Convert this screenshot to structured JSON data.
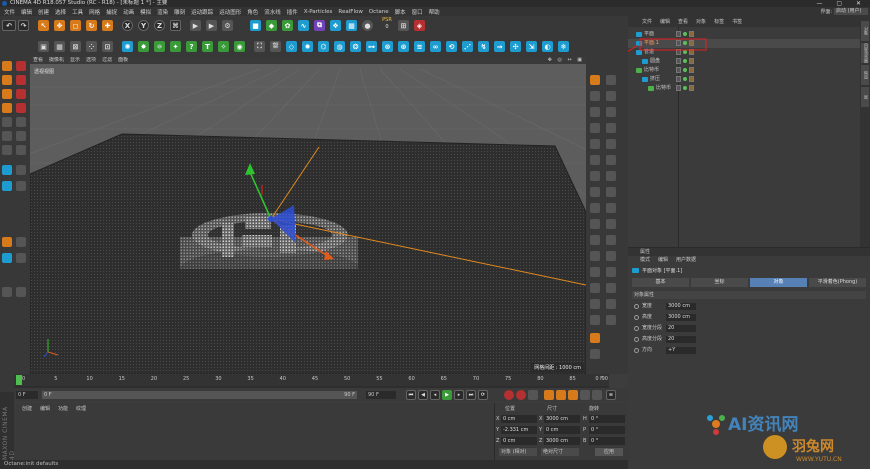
{
  "titlebar": {
    "title": "CINEMA 4D R18.057 Studio (RC - R18) - [未标题 1 *] - 主要",
    "controls": "— ▢ ✕"
  },
  "menubar": {
    "items": [
      "文件",
      "编辑",
      "创建",
      "选择",
      "工具",
      "网格",
      "捕捉",
      "动画",
      "模拟",
      "渲染",
      "雕刻",
      "运动跟踪",
      "运动图形",
      "角色",
      "流水线",
      "插件",
      "X-Particles",
      "RealFlow",
      "Octane",
      "脚本",
      "窗口",
      "帮助"
    ]
  },
  "layout": {
    "label": "界面:",
    "value": "启动 (用户)"
  },
  "toolbar": {
    "xyz": [
      "X",
      "Y",
      "Z"
    ],
    "psr": "PSR",
    "psr_value": "0"
  },
  "viewport": {
    "menu": [
      "查看",
      "摄像机",
      "显示",
      "选项",
      "过滤",
      "面板"
    ],
    "camera_label": "透视视图",
    "grid_info": "网格间距 : 1000 cm",
    "corner_icons": "✥ ◎ ↔ ▣"
  },
  "timeline": {
    "ticks": [
      "0",
      "5",
      "10",
      "15",
      "20",
      "25",
      "30",
      "35",
      "40",
      "45",
      "50",
      "55",
      "60",
      "65",
      "70",
      "75",
      "80",
      "85",
      "90"
    ],
    "end_label": "0 F",
    "start_field": "0 F",
    "range_start": "0 F",
    "range_end": "90 F",
    "end_field": "90 F"
  },
  "material_panel": {
    "menu": [
      "创建",
      "编辑",
      "功能",
      "纹理"
    ]
  },
  "coord_panel": {
    "headers": [
      "位置",
      "尺寸",
      "旋转"
    ],
    "rows": [
      {
        "axis": "X",
        "pos": "0 cm",
        "saxis": "X",
        "size": "3000 cm",
        "raxis": "H",
        "rot": "0 °"
      },
      {
        "axis": "Y",
        "pos": "-2.331 cm",
        "saxis": "Y",
        "size": "0 cm",
        "raxis": "P",
        "rot": "0 °"
      },
      {
        "axis": "Z",
        "pos": "0 cm",
        "saxis": "Z",
        "size": "3000 cm",
        "raxis": "B",
        "rot": "0 °"
      }
    ],
    "mode1": "对象 (相对)",
    "mode2": "绝对尺寸",
    "apply": "应用"
  },
  "statusbar": {
    "text": "Octane:init defaults"
  },
  "brand_side": "MAXON CINEMA 4D",
  "object_manager": {
    "menu": [
      "文件",
      "编辑",
      "查看",
      "对象",
      "标签",
      "书签"
    ],
    "objects": [
      {
        "name": "平面",
        "indent": 0,
        "selected": false
      },
      {
        "name": "平面.1",
        "indent": 0,
        "selected": true
      },
      {
        "name": "管道",
        "indent": 0,
        "selected": false
      },
      {
        "name": "圆盘",
        "indent": 1,
        "selected": false
      },
      {
        "name": "比特币",
        "indent": 0,
        "selected": false
      },
      {
        "name": "挤压",
        "indent": 1,
        "selected": false
      },
      {
        "name": "比特币",
        "indent": 2,
        "selected": false
      }
    ]
  },
  "right_tabs": [
    "对象",
    "内容浏览器",
    "构造",
    "层"
  ],
  "attribute_manager": {
    "header": "属性",
    "menu": [
      "模式",
      "编辑",
      "用户数据"
    ],
    "object_title": "平面对象 [平面.1]",
    "tabs": [
      "基本",
      "坐标",
      "对象",
      "平滑着色(Phong)"
    ],
    "active_tab": "对象",
    "section": "对象属性",
    "props": [
      {
        "label": "宽度",
        "value": "3000 cm"
      },
      {
        "label": "高度",
        "value": "3000 cm"
      },
      {
        "label": "宽度分段",
        "value": "20"
      },
      {
        "label": "高度分段",
        "value": "20"
      },
      {
        "label": "方向",
        "value": "+Y"
      }
    ]
  },
  "watermark": {
    "line1": "AI资讯网",
    "line2": "羽兔网",
    "url": "WWW.YUTU.CN"
  },
  "colors": {
    "accent_blue": "#5780b5",
    "axis_x": "#e05a1a",
    "axis_y": "#2fc42f",
    "axis_z": "#2c4fd6",
    "selection_red": "#e02020"
  }
}
